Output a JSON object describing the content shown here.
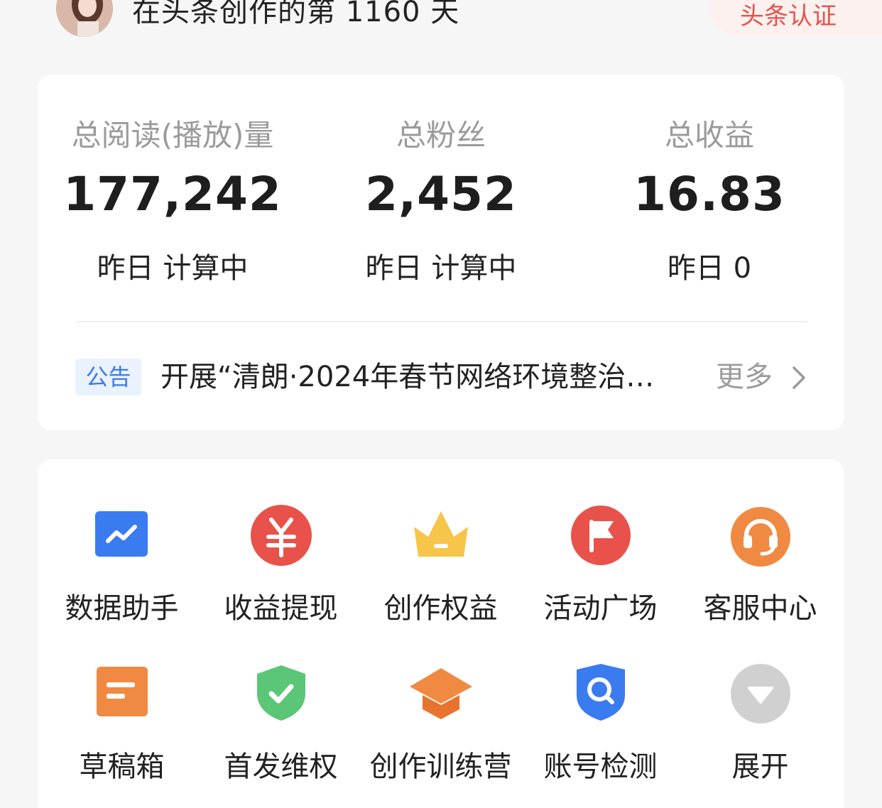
{
  "header": {
    "days_text": "在头条创作的第 1160 天",
    "cert_label": "头条认证"
  },
  "stats": [
    {
      "label": "总阅读(播放)量",
      "value": "177,242",
      "sub": "昨日 计算中"
    },
    {
      "label": "总粉丝",
      "value": "2,452",
      "sub": "昨日 计算中"
    },
    {
      "label": "总收益",
      "value": "16.83",
      "sub": "昨日 0"
    }
  ],
  "notice": {
    "tag": "公告",
    "text": "开展“清朗·2024年春节网络环境整治…",
    "more": "更多"
  },
  "tools": {
    "row1": [
      {
        "label": "数据助手",
        "icon": "chart-trend-icon"
      },
      {
        "label": "收益提现",
        "icon": "yuan-coin-icon"
      },
      {
        "label": "创作权益",
        "icon": "crown-icon"
      },
      {
        "label": "活动广场",
        "icon": "flag-icon"
      },
      {
        "label": "客服中心",
        "icon": "headset-icon"
      }
    ],
    "row2": [
      {
        "label": "草稿箱",
        "icon": "draft-box-icon"
      },
      {
        "label": "首发维权",
        "icon": "shield-check-icon"
      },
      {
        "label": "创作训练营",
        "icon": "graduation-cap-icon"
      },
      {
        "label": "账号检测",
        "icon": "shield-search-icon"
      },
      {
        "label": "展开",
        "icon": "expand-down-icon"
      }
    ]
  },
  "colors": {
    "accent_red": "#e8524a",
    "notice_blue": "#3e7be6",
    "muted_gray": "#9b9b9b"
  }
}
